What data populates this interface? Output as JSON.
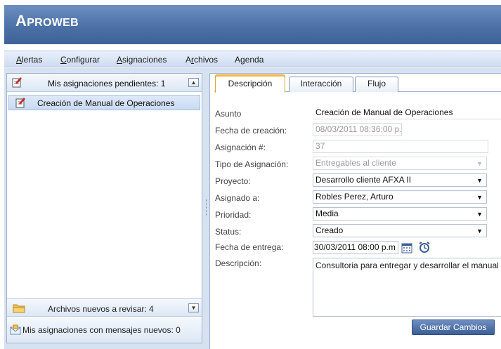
{
  "app": {
    "title": "Aproweb"
  },
  "menu": [
    {
      "label": "Alertas",
      "accel": "A"
    },
    {
      "label": "Configurar",
      "accel": "C"
    },
    {
      "label": "Asignaciones",
      "accel": "A"
    },
    {
      "label": "Archivos",
      "accel": "r"
    },
    {
      "label": "Agenda",
      "accel": "g"
    }
  ],
  "left": {
    "pending_header": "Mis asignaciones pendientes: 1",
    "items": [
      {
        "label": "Creación de Manual de Operaciones"
      }
    ],
    "files_header": "Archivos nuevos a revisar: 4",
    "messages_header": "Mis asignaciones con mensajes nuevos: 0"
  },
  "tabs": [
    "Descripción",
    "Interacción",
    "Flujo"
  ],
  "form": {
    "asunto_label": "Asunto",
    "asunto_value": "Creación de Manual de Operaciones",
    "fecha_creacion_label": "Fecha de creación:",
    "fecha_creacion_value": "08/03/2011 08:36:00 p.",
    "asignacion_label": "Asignación #:",
    "asignacion_value": "37",
    "tipo_label": "Tipo de Asignación:",
    "tipo_value": "Entregables al cliente",
    "proyecto_label": "Proyecto:",
    "proyecto_value": "Desarrollo cliente AFXA II",
    "asignado_label": "Asignado a:",
    "asignado_value": "Robles Perez, Arturo",
    "prioridad_label": "Prioridad:",
    "prioridad_value": "Media",
    "status_label": "Status:",
    "status_value": "Creado",
    "fecha_entrega_label": "Fecha de entrega:",
    "fecha_entrega_value": "30/03/2011 08:00 p.m",
    "descripcion_label": "Descripción:",
    "descripcion_value": "Consultoria para entregar y desarrollar el manual",
    "save_label": "Guardar Cambios"
  },
  "colors": {
    "header": "#4a6fa5",
    "accent_tab": "#f5b841",
    "selection": "#c9daf2"
  }
}
